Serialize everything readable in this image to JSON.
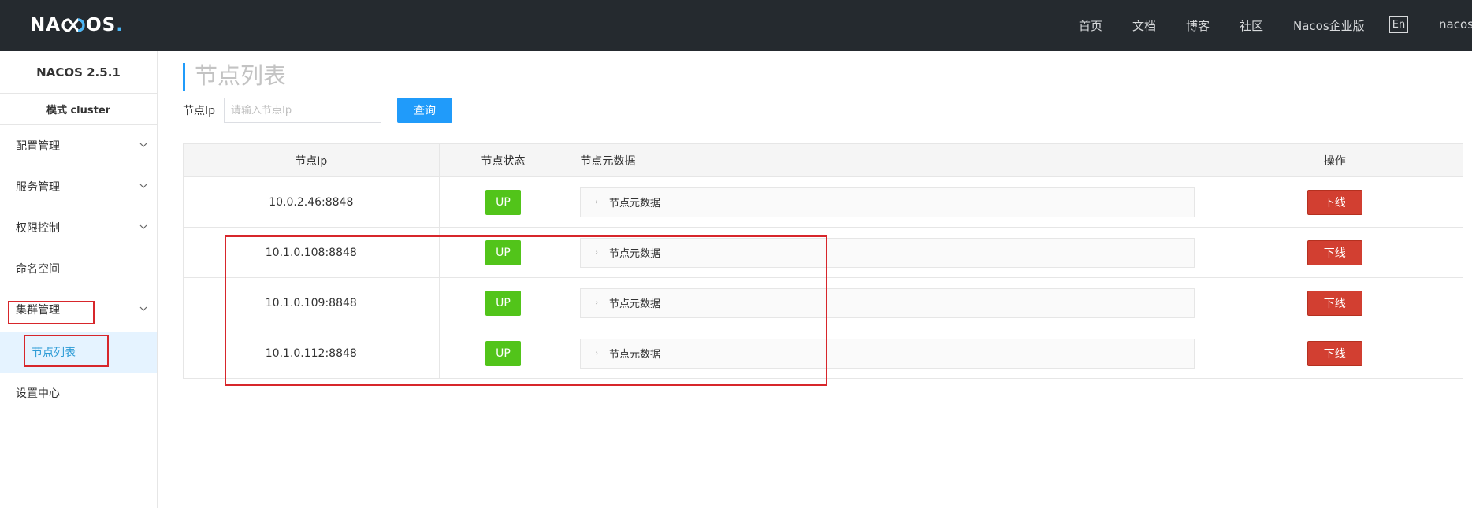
{
  "header": {
    "logo_text_a": "NA",
    "logo_text_b": "OS",
    "logo_dot": ".",
    "nav": [
      {
        "label": "首页"
      },
      {
        "label": "文档"
      },
      {
        "label": "博客"
      },
      {
        "label": "社区"
      },
      {
        "label": "Nacos企业版"
      }
    ],
    "lang_label": "En",
    "user_label": "nacos"
  },
  "sidebar": {
    "version": "NACOS 2.5.1",
    "mode": "模式 cluster",
    "items": [
      {
        "label": "配置管理",
        "expandable": true
      },
      {
        "label": "服务管理",
        "expandable": true
      },
      {
        "label": "权限控制",
        "expandable": true
      },
      {
        "label": "命名空间",
        "expandable": false
      },
      {
        "label": "集群管理",
        "expandable": true
      },
      {
        "label": "设置中心",
        "expandable": false
      }
    ],
    "active_sub": "节点列表"
  },
  "main": {
    "title": "节点列表",
    "search": {
      "label": "节点Ip",
      "placeholder": "请输入节点Ip",
      "button_label": "查询"
    },
    "table": {
      "columns": [
        "节点Ip",
        "节点状态",
        "节点元数据",
        "操作"
      ],
      "rows": [
        {
          "ip": "10.0.2.46:8848",
          "status": "UP",
          "metadata": "节点元数据",
          "action": "下线"
        },
        {
          "ip": "10.1.0.108:8848",
          "status": "UP",
          "metadata": "节点元数据",
          "action": "下线"
        },
        {
          "ip": "10.1.0.109:8848",
          "status": "UP",
          "metadata": "节点元数据",
          "action": "下线"
        },
        {
          "ip": "10.1.0.112:8848",
          "status": "UP",
          "metadata": "节点元数据",
          "action": "下线"
        }
      ]
    }
  },
  "colors": {
    "header_bg": "#252a2f",
    "accent": "#209bfa",
    "status_up": "#52c41a",
    "danger": "#d23f31",
    "annotation": "#d7262b"
  }
}
